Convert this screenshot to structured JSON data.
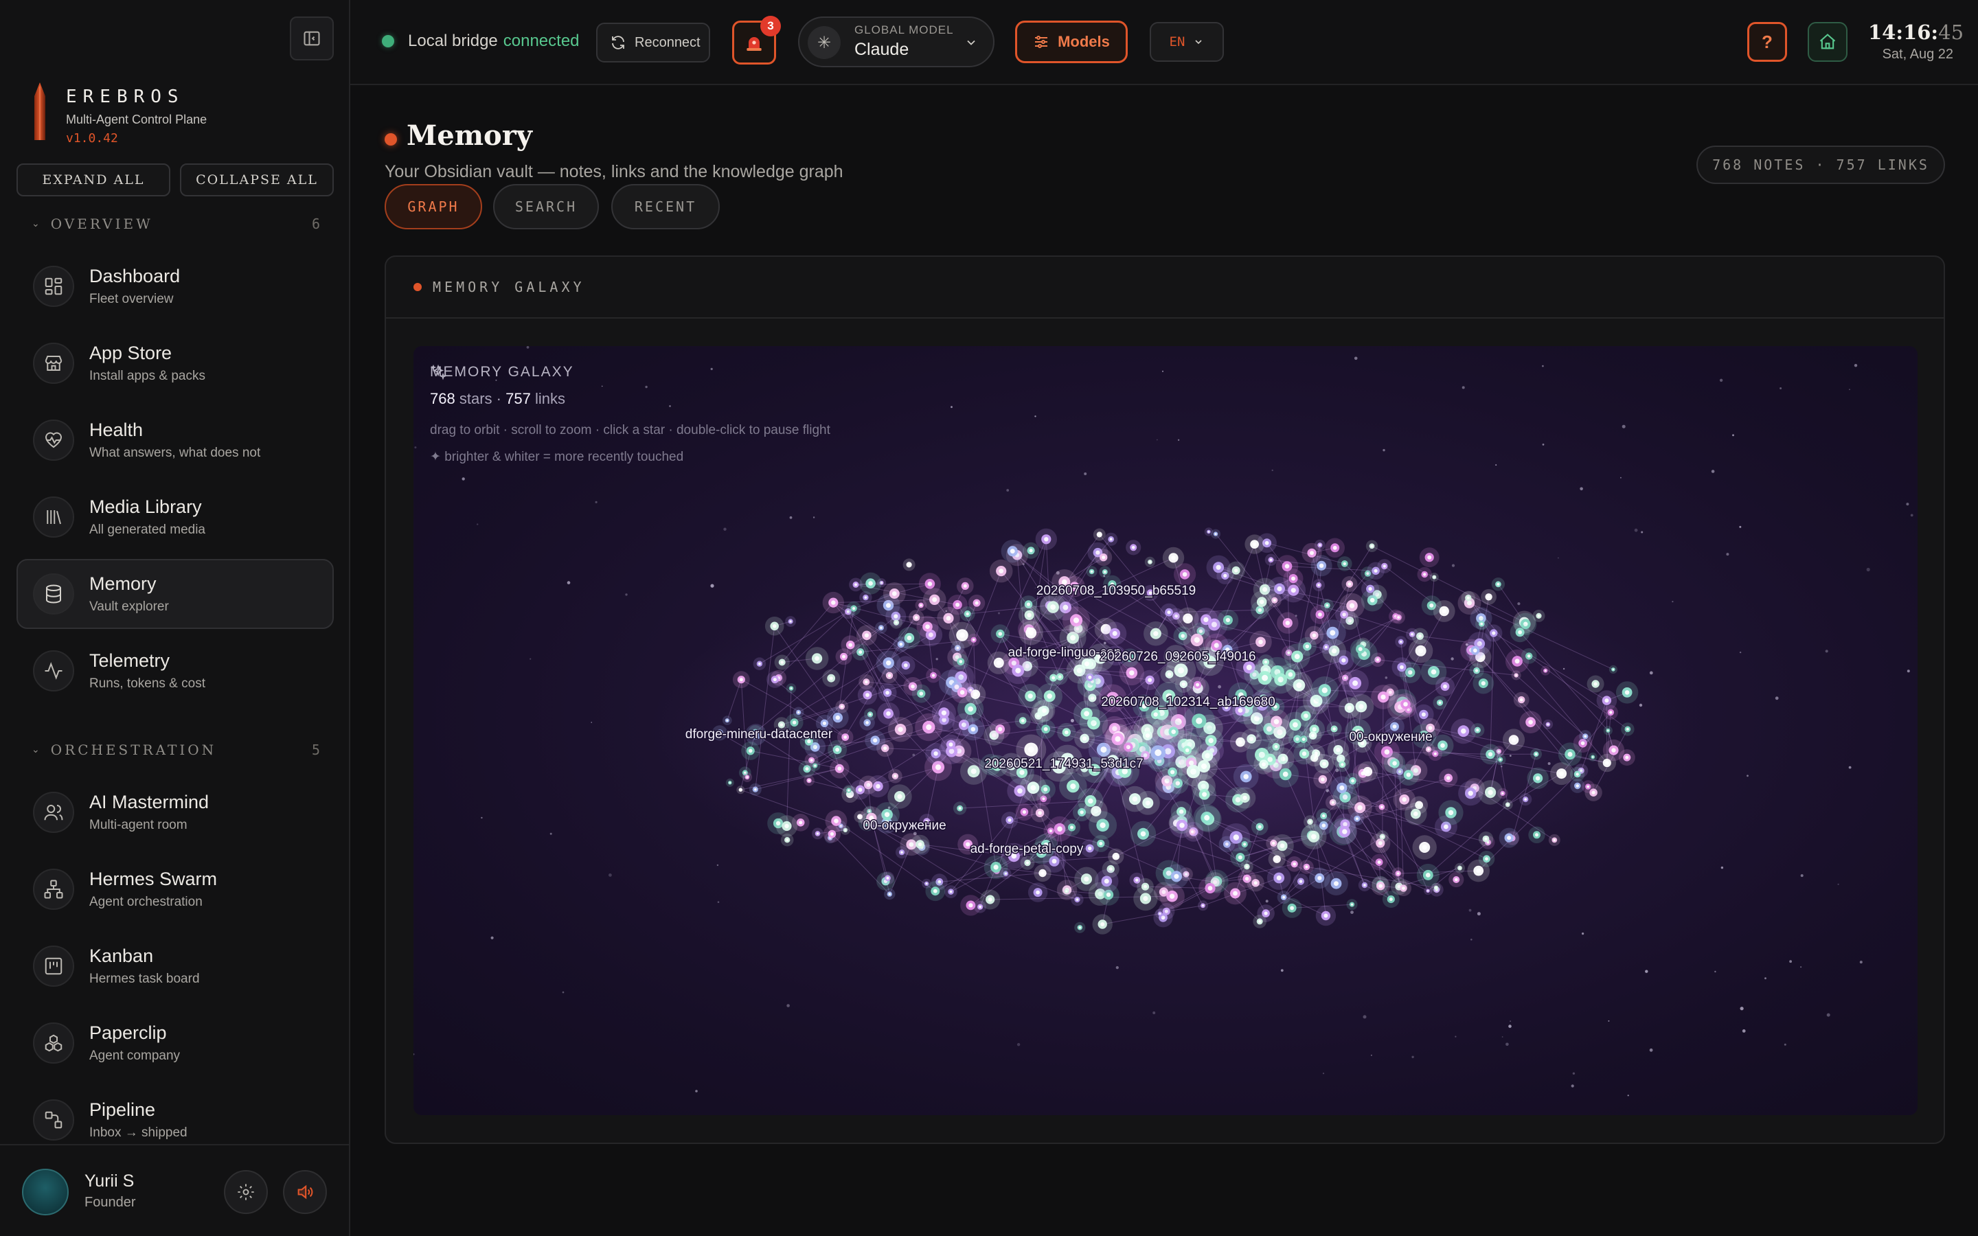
{
  "app": {
    "name": "EREBROS",
    "subtitle": "Multi-Agent Control Plane",
    "version": "v1.0.42",
    "expand_all": "EXPAND ALL",
    "collapse_all": "COLLAPSE ALL"
  },
  "sidebar": {
    "sections": [
      {
        "title": "OVERVIEW",
        "count": "6",
        "items": [
          {
            "label": "Dashboard",
            "sub": "Fleet overview",
            "icon": "grid-icon"
          },
          {
            "label": "App Store",
            "sub": "Install apps & packs",
            "icon": "store-icon"
          },
          {
            "label": "Health",
            "sub": "What answers, what does not",
            "icon": "heart-pulse-icon"
          },
          {
            "label": "Media Library",
            "sub": "All generated media",
            "icon": "library-icon"
          },
          {
            "label": "Memory",
            "sub": "Vault explorer",
            "icon": "database-icon",
            "active": true
          },
          {
            "label": "Telemetry",
            "sub": "Runs, tokens & cost",
            "icon": "activity-icon"
          }
        ]
      },
      {
        "title": "ORCHESTRATION",
        "count": "5",
        "items": [
          {
            "label": "AI Mastermind",
            "sub": "Multi-agent room",
            "icon": "users-icon"
          },
          {
            "label": "Hermes Swarm",
            "sub": "Agent orchestration",
            "icon": "network-icon"
          },
          {
            "label": "Kanban",
            "sub": "Hermes task board",
            "icon": "kanban-icon"
          },
          {
            "label": "Paperclip",
            "sub": "Agent company",
            "icon": "boxes-icon"
          },
          {
            "label": "Pipeline",
            "sub": "Inbox → shipped",
            "icon": "pipeline-icon"
          }
        ]
      }
    ],
    "user": {
      "name": "Yurii S",
      "role": "Founder"
    }
  },
  "topbar": {
    "bridge_prefix": "Local bridge",
    "bridge_status": "connected",
    "reconnect": "Reconnect",
    "alerts_count": "3",
    "model_label": "GLOBAL MODEL",
    "model_value": "Claude",
    "models_button": "Models",
    "language": "EN",
    "help": "?",
    "time_hm": "14:16:",
    "time_s": "45",
    "date": "Sat, Aug 22"
  },
  "page": {
    "title": "Memory",
    "subtitle": "Your Obsidian vault — notes, links and the knowledge graph",
    "stats": "768 NOTES · 757 LINKS",
    "tabs": [
      "GRAPH",
      "SEARCH",
      "RECENT"
    ],
    "active_tab": "GRAPH"
  },
  "card": {
    "title": "MEMORY GALAXY"
  },
  "galaxy": {
    "title": "MEMORY GALAXY",
    "stars": "768",
    "stars_label": "stars ·",
    "links": "757",
    "links_label": "links",
    "hint": "drag to orbit · scroll to zoom · click a star · double-click to pause flight",
    "legend": "✦ brighter & whiter = more recently touched",
    "labels": [
      "20260708_103950_b65519",
      "ad-forge-linguo-cop",
      "20260726_092605_f49016",
      "20260708_102314_ab169680",
      "dforge-mineru-datacenter",
      "00-окружение",
      "20260521_174931_53d1c7",
      "00-окружение",
      "ad-forge-petal-copy"
    ]
  },
  "colors": {
    "accent": "#e0552a",
    "ok": "#58c78e",
    "galaxy_bg": "#1f1433"
  }
}
